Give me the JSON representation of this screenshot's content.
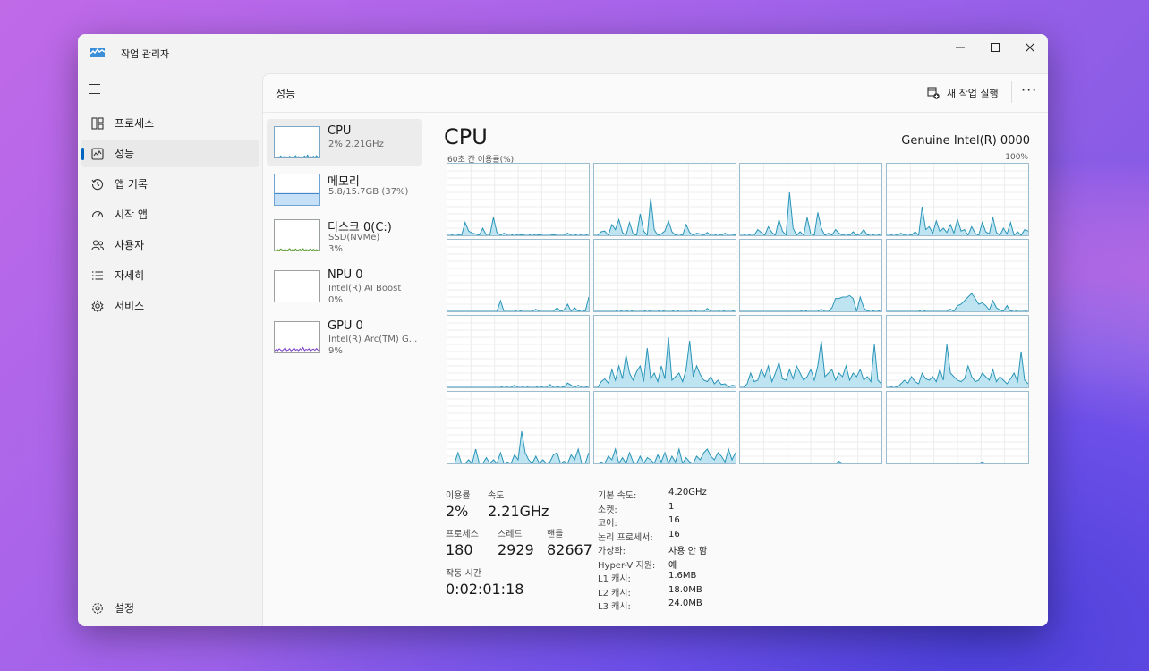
{
  "window": {
    "title": "작업 관리자"
  },
  "controls": {
    "minimize": "—",
    "maximize": "☐",
    "close": "✕"
  },
  "sidebar": {
    "items": [
      {
        "label": "프로세스",
        "icon": "processes-icon"
      },
      {
        "label": "성능",
        "icon": "performance-icon",
        "active": true
      },
      {
        "label": "앱 기록",
        "icon": "app-history-icon"
      },
      {
        "label": "시작 앱",
        "icon": "startup-apps-icon"
      },
      {
        "label": "사용자",
        "icon": "users-icon"
      },
      {
        "label": "자세히",
        "icon": "details-icon"
      },
      {
        "label": "서비스",
        "icon": "services-icon"
      }
    ],
    "settings": {
      "label": "설정",
      "icon": "settings-icon"
    }
  },
  "header": {
    "title": "성능",
    "new_task": "새 작업 실행",
    "more": "···"
  },
  "devices": [
    {
      "name": "CPU",
      "lines": [
        "2% 2.21GHz"
      ]
    },
    {
      "name": "메모리",
      "lines": [
        "5.8/15.7GB (37%)"
      ]
    },
    {
      "name": "디스크 0(C:)",
      "lines": [
        "SSD(NVMe)",
        "3%"
      ]
    },
    {
      "name": "NPU 0",
      "lines": [
        "Intel(R) AI Boost",
        "0%"
      ]
    },
    {
      "name": "GPU 0",
      "lines": [
        "Intel(R) Arc(TM) G...",
        "9%"
      ]
    }
  ],
  "cpu": {
    "title": "CPU",
    "model": "Genuine Intel(R) 0000",
    "caption_left": "60초 간 이용률(%)",
    "caption_right": "100%",
    "stats": {
      "util_label": "이용률",
      "util_value": "2%",
      "speed_label": "속도",
      "speed_value": "2.21GHz",
      "proc_label": "프로세스",
      "proc_value": "180",
      "thread_label": "스레드",
      "thread_value": "2929",
      "handle_label": "핸들",
      "handle_value": "82667",
      "uptime_label": "작동 시간",
      "uptime_value": "0:02:01:18"
    },
    "specs": [
      {
        "label": "기본 속도:",
        "value": "4.20GHz"
      },
      {
        "label": "소켓:",
        "value": "1"
      },
      {
        "label": "코어:",
        "value": "16"
      },
      {
        "label": "논리 프로세서:",
        "value": "16"
      },
      {
        "label": "가상화:",
        "value": "사용 안 함"
      },
      {
        "label": "Hyper-V 지원:",
        "value": "예"
      },
      {
        "label": "L1 캐시:",
        "value": "1.6MB"
      },
      {
        "label": "L2 캐시:",
        "value": "18.0MB"
      },
      {
        "label": "L3 캐시:",
        "value": "24.0MB"
      }
    ]
  },
  "chart_data": {
    "type": "area",
    "ylim": [
      0,
      100
    ],
    "grid": true,
    "core_count": 16,
    "cores": [
      [
        0,
        0,
        2,
        1,
        0,
        18,
        6,
        3,
        2,
        0,
        10,
        0,
        0,
        25,
        4,
        0,
        3,
        0,
        0,
        2,
        0,
        1,
        0,
        0,
        2,
        0,
        1,
        0,
        0,
        0,
        1,
        0,
        0,
        0,
        3,
        0,
        0,
        2,
        0,
        0,
        2
      ],
      [
        0,
        0,
        5,
        6,
        0,
        15,
        8,
        22,
        4,
        0,
        18,
        2,
        0,
        30,
        6,
        0,
        52,
        8,
        0,
        2,
        6,
        20,
        5,
        0,
        2,
        0,
        15,
        4,
        0,
        3,
        2,
        0,
        4,
        0,
        0,
        2,
        0,
        3,
        0,
        0,
        1
      ],
      [
        0,
        0,
        2,
        0,
        0,
        8,
        4,
        0,
        12,
        4,
        0,
        22,
        6,
        0,
        60,
        10,
        0,
        5,
        0,
        25,
        2,
        0,
        32,
        10,
        0,
        3,
        0,
        8,
        3,
        0,
        2,
        0,
        5,
        0,
        2,
        8,
        0,
        2,
        0,
        0,
        2
      ],
      [
        0,
        0,
        2,
        0,
        3,
        0,
        2,
        0,
        5,
        0,
        40,
        8,
        12,
        3,
        20,
        5,
        10,
        4,
        15,
        3,
        22,
        6,
        8,
        0,
        12,
        3,
        0,
        18,
        5,
        2,
        25,
        4,
        0,
        10,
        2,
        18,
        0,
        5,
        0,
        8,
        6
      ],
      [
        0,
        0,
        0,
        0,
        0,
        0,
        0,
        0,
        0,
        0,
        0,
        0,
        0,
        0,
        0,
        15,
        0,
        0,
        0,
        0,
        2,
        0,
        0,
        0,
        0,
        3,
        0,
        0,
        0,
        0,
        0,
        5,
        0,
        2,
        10,
        0,
        5,
        0,
        2,
        0,
        20
      ],
      [
        0,
        0,
        0,
        0,
        0,
        0,
        0,
        2,
        0,
        0,
        2,
        0,
        0,
        0,
        0,
        2,
        0,
        0,
        0,
        2,
        0,
        0,
        0,
        2,
        0,
        0,
        0,
        0,
        2,
        0,
        0,
        0,
        4,
        0,
        0,
        0,
        2,
        0,
        0,
        0,
        2
      ],
      [
        0,
        0,
        0,
        0,
        0,
        0,
        0,
        0,
        0,
        0,
        0,
        0,
        0,
        0,
        0,
        0,
        0,
        0,
        2,
        0,
        0,
        0,
        0,
        3,
        0,
        0,
        5,
        18,
        18,
        20,
        20,
        22,
        18,
        0,
        20,
        5,
        0,
        2,
        0,
        0,
        2
      ],
      [
        0,
        0,
        0,
        0,
        0,
        0,
        0,
        0,
        0,
        0,
        2,
        0,
        0,
        0,
        0,
        0,
        0,
        0,
        3,
        0,
        8,
        10,
        15,
        20,
        25,
        18,
        10,
        12,
        8,
        2,
        15,
        5,
        2,
        0,
        8,
        0,
        2,
        0,
        0,
        0,
        2
      ],
      [
        0,
        0,
        0,
        0,
        0,
        0,
        0,
        0,
        0,
        0,
        0,
        0,
        0,
        0,
        0,
        0,
        2,
        0,
        0,
        3,
        0,
        0,
        2,
        0,
        0,
        0,
        2,
        0,
        0,
        4,
        0,
        0,
        2,
        0,
        6,
        3,
        0,
        3,
        0,
        0,
        2
      ],
      [
        0,
        0,
        8,
        12,
        6,
        25,
        10,
        30,
        12,
        45,
        20,
        10,
        22,
        30,
        8,
        55,
        12,
        20,
        8,
        30,
        12,
        70,
        10,
        15,
        20,
        8,
        25,
        65,
        15,
        30,
        18,
        10,
        8,
        15,
        5,
        10,
        4,
        5,
        0,
        3,
        2
      ],
      [
        0,
        0,
        5,
        20,
        8,
        10,
        25,
        15,
        30,
        8,
        20,
        35,
        12,
        10,
        25,
        12,
        30,
        20,
        10,
        15,
        25,
        10,
        30,
        65,
        15,
        20,
        25,
        10,
        20,
        15,
        30,
        10,
        20,
        15,
        25,
        10,
        15,
        8,
        60,
        10,
        5
      ],
      [
        0,
        0,
        2,
        0,
        5,
        10,
        6,
        15,
        8,
        5,
        20,
        12,
        10,
        15,
        8,
        25,
        10,
        60,
        20,
        15,
        10,
        8,
        12,
        30,
        15,
        8,
        10,
        20,
        15,
        10,
        25,
        8,
        15,
        10,
        5,
        12,
        20,
        8,
        50,
        10,
        5
      ],
      [
        0,
        0,
        0,
        15,
        0,
        0,
        5,
        0,
        20,
        0,
        0,
        8,
        0,
        5,
        0,
        15,
        0,
        2,
        0,
        12,
        5,
        45,
        15,
        5,
        0,
        10,
        0,
        5,
        0,
        2,
        12,
        15,
        0,
        3,
        0,
        12,
        5,
        20,
        0,
        0,
        15
      ],
      [
        0,
        0,
        2,
        0,
        10,
        5,
        20,
        0,
        8,
        0,
        15,
        2,
        0,
        10,
        0,
        8,
        5,
        0,
        12,
        2,
        15,
        0,
        10,
        2,
        20,
        0,
        8,
        2,
        0,
        10,
        5,
        15,
        20,
        10,
        5,
        15,
        10,
        2,
        20,
        5,
        15
      ],
      [
        0,
        0,
        0,
        0,
        0,
        0,
        0,
        0,
        0,
        0,
        0,
        0,
        0,
        0,
        0,
        0,
        0,
        0,
        0,
        0,
        0,
        0,
        0,
        0,
        0,
        0,
        0,
        0,
        3,
        0,
        0,
        0,
        0,
        0,
        0,
        0,
        0,
        0,
        0,
        0,
        0
      ],
      [
        0,
        0,
        0,
        0,
        0,
        0,
        0,
        0,
        0,
        0,
        0,
        0,
        0,
        0,
        0,
        0,
        0,
        0,
        0,
        0,
        0,
        0,
        0,
        0,
        0,
        0,
        0,
        2,
        0,
        0,
        0,
        0,
        0,
        0,
        0,
        0,
        0,
        0,
        0,
        0,
        0
      ]
    ],
    "thumbnails": {
      "cpu": [
        0,
        0,
        2,
        0,
        5,
        0,
        3,
        0,
        2,
        0,
        4,
        0,
        2,
        0,
        6,
        0,
        3,
        0,
        2,
        0,
        5,
        0,
        8,
        0,
        3,
        0,
        4,
        0,
        6,
        0,
        2
      ],
      "memory_percent": 37,
      "disk": [
        0,
        0,
        3,
        0,
        5,
        2,
        0,
        4,
        0,
        2,
        6,
        0,
        3,
        0,
        5,
        0,
        2,
        4,
        0,
        6,
        0,
        3,
        0,
        2,
        5,
        0,
        4,
        0,
        3,
        0,
        2
      ],
      "npu": [
        0
      ],
      "gpu": [
        5,
        10,
        6,
        12,
        8,
        5,
        10,
        15,
        6,
        8,
        12,
        5,
        9,
        14,
        7,
        10,
        6,
        12,
        8,
        16,
        6,
        10,
        8,
        12,
        5,
        9,
        11,
        7,
        13,
        8,
        6
      ]
    },
    "colors": {
      "cpu_line": "#2a95b8",
      "cpu_fill": "#bfe4f1",
      "mem_fill": "#c6e0f7",
      "mem_line": "#2f7bbf",
      "disk": "#5b9a2c",
      "gpu": "#7a3fc6"
    }
  }
}
